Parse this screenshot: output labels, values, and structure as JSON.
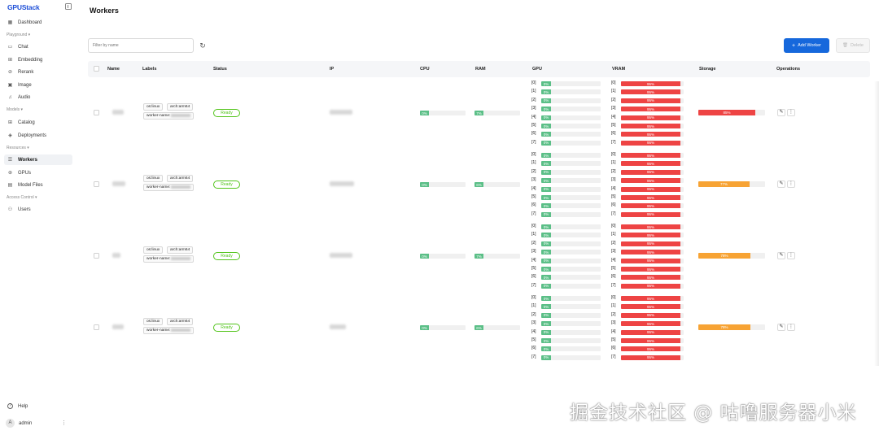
{
  "app": {
    "logo": "GPUStack"
  },
  "page": {
    "title": "Workers"
  },
  "sidebar": {
    "dashboard": "Dashboard",
    "groups": {
      "playground": "Playground",
      "models": "Models",
      "resources": "Resources",
      "access_control": "Access Control"
    },
    "items": {
      "chat": "Chat",
      "embedding": "Embedding",
      "rerank": "Rerank",
      "image": "Image",
      "audio": "Audio",
      "catalog": "Catalog",
      "deployments": "Deployments",
      "workers": "Workers",
      "gpus": "GPUs",
      "model_files": "Model Files",
      "users": "Users"
    },
    "help": "Help",
    "user": {
      "avatar": "A",
      "name": "admin"
    }
  },
  "toolbar": {
    "filter_placeholder": "Filter by name",
    "add_label": "Add Worker",
    "delete_label": "Delete"
  },
  "table": {
    "columns": {
      "name": "Name",
      "labels": "Labels",
      "status": "Status",
      "ip": "IP",
      "cpu": "CPU",
      "ram": "RAM",
      "gpu": "GPU",
      "vram": "VRAM",
      "storage": "Storage",
      "operations": "Operations"
    },
    "gpu_indices": [
      "[0]",
      "[1]",
      "[2]",
      "[3]",
      "[4]",
      "[5]",
      "[6]",
      "[7]"
    ],
    "rows": [
      {
        "tags": {
          "os": "os:linux",
          "arch": "arch:arm64",
          "worker": "worker-name:"
        },
        "status": "Ready",
        "cpu": 0,
        "ram": 7,
        "gpu": [
          0,
          0,
          0,
          0,
          0,
          0,
          0,
          0
        ],
        "vram": [
          95,
          95,
          95,
          95,
          95,
          95,
          95,
          95
        ],
        "storage": 85,
        "storage_level": "red"
      },
      {
        "tags": {
          "os": "os:linux",
          "arch": "arch:arm64",
          "worker": "worker-name:"
        },
        "status": "Ready",
        "cpu": 0,
        "ram": 6,
        "gpu": [
          0,
          0,
          0,
          0,
          0,
          0,
          0,
          0
        ],
        "vram": [
          95,
          95,
          95,
          95,
          95,
          95,
          95,
          95
        ],
        "storage": 77,
        "storage_level": "orange"
      },
      {
        "tags": {
          "os": "os:linux",
          "arch": "arch:arm64",
          "worker": "worker-name:"
        },
        "status": "Ready",
        "cpu": 0,
        "ram": 7,
        "gpu": [
          0,
          0,
          0,
          0,
          0,
          0,
          0,
          0
        ],
        "vram": [
          95,
          95,
          95,
          95,
          95,
          95,
          95,
          95
        ],
        "storage": 78,
        "storage_level": "orange"
      },
      {
        "tags": {
          "os": "os:linux",
          "arch": "arch:arm64",
          "worker": "worker-name:"
        },
        "status": "Ready",
        "cpu": 0,
        "ram": 6,
        "gpu": [
          0,
          0,
          0,
          0,
          0,
          0,
          0,
          0
        ],
        "vram": [
          95,
          95,
          95,
          95,
          95,
          95,
          95,
          95
        ],
        "storage": 78,
        "storage_level": "orange"
      }
    ]
  },
  "watermark": "掘金技术社区 @ 咕噜服务器小米",
  "colors": {
    "primary": "#1668dc",
    "ready": "#52c41a",
    "usage_low": "#5bbf87",
    "usage_high": "#ee4444",
    "usage_mid": "#f7a334"
  }
}
